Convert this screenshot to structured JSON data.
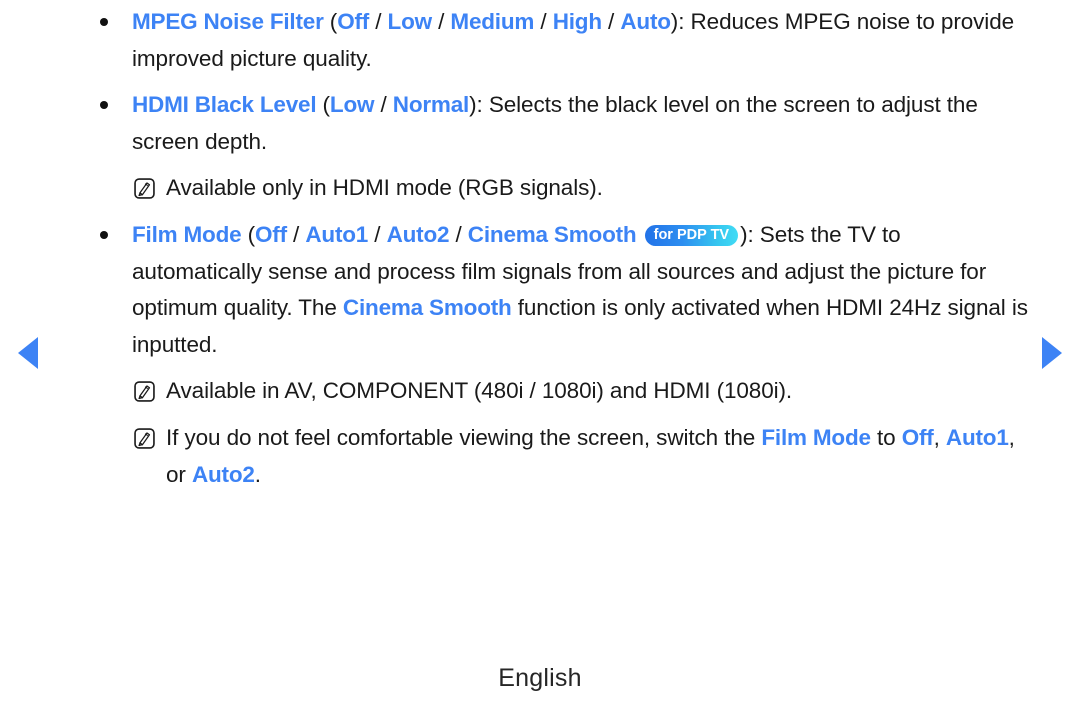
{
  "page": {
    "language_footer": "English",
    "accent_color": "#3d83f5",
    "text_color": "#1a1a1a",
    "badge_gradient_start": "#2272e8",
    "badge_gradient_end": "#41dcf5"
  },
  "nav": {
    "prev_icon": "triangle-left-icon",
    "next_icon": "triangle-right-icon",
    "prev_label": "Previous page",
    "next_label": "Next page"
  },
  "items": [
    {
      "type": "bullet",
      "icon": "bullet-dot",
      "keyword": "MPEG Noise Filter",
      "open_paren": " (",
      "options": [
        "Off",
        "Low",
        "Medium",
        "High",
        "Auto"
      ],
      "separator": " / ",
      "close_paren": ")",
      "body": ": Reduces MPEG noise to provide improved picture quality."
    },
    {
      "type": "bullet",
      "icon": "bullet-dot",
      "keyword": "HDMI Black Level",
      "open_paren": " (",
      "options": [
        "Low",
        "Normal"
      ],
      "separator": " / ",
      "close_paren": ")",
      "body": ": Selects the black level on the screen to adjust the screen depth."
    },
    {
      "type": "note",
      "icon": "note-pencil-icon",
      "body": "Available only in HDMI mode (RGB signals)."
    },
    {
      "type": "bullet",
      "icon": "bullet-dot",
      "keyword": "Film Mode",
      "open_paren": " (",
      "options": [
        "Off",
        "Auto1",
        "Auto2",
        "Cinema Smooth"
      ],
      "separator": " / ",
      "badge": "for PDP TV",
      "close_paren": ")",
      "body_a": ": Sets the TV to automatically sense and process film signals from all sources and adjust the picture for optimum quality. The ",
      "inline_kw": "Cinema Smooth",
      "body_b": " function is only activated when HDMI 24Hz signal is inputted."
    },
    {
      "type": "note",
      "icon": "note-pencil-icon",
      "body": "Available in AV, COMPONENT (480i / 1080i) and HDMI (1080i)."
    },
    {
      "type": "note",
      "icon": "note-pencil-icon",
      "body_a": "If you do not feel comfortable viewing the screen, switch the ",
      "inline_kw": "Film Mode",
      "body_b": " to ",
      "tail_options": [
        "Off",
        "Auto1",
        "Auto2"
      ],
      "tail_sep1": ", ",
      "tail_sep2": ", or ",
      "tail_end": "."
    }
  ]
}
